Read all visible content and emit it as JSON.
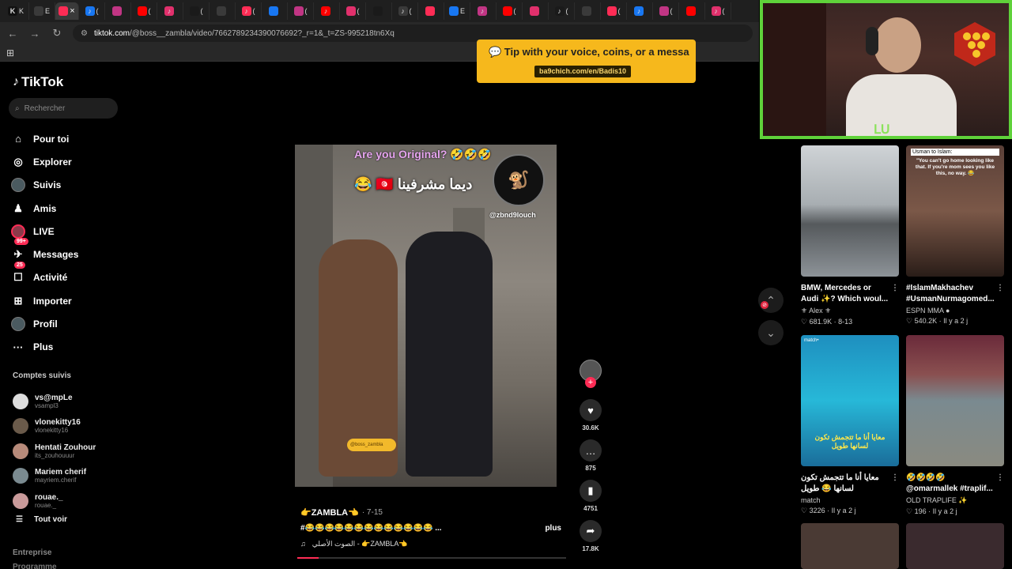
{
  "browser": {
    "tabs": [
      "K",
      "E",
      "",
      "(",
      "",
      "(",
      "",
      "(",
      "",
      "(",
      "",
      "(",
      "",
      "(",
      "",
      "(",
      "",
      "E",
      "",
      "(",
      "",
      "(",
      "",
      "(",
      "",
      "(",
      "",
      "(",
      "",
      "(",
      "",
      "(",
      "",
      "(",
      "",
      "t",
      "",
      "(",
      "",
      "(",
      "",
      "(",
      "",
      "("
    ],
    "url_host": "tiktok.com",
    "url_path": "/@boss__zambla/video/7662789234390076692?_r=1&_t=ZS-995218tn6Xq"
  },
  "sidebar": {
    "logo": "TikTok",
    "search_placeholder": "Rechercher",
    "menu": [
      {
        "label": "Pour toi",
        "icon": "home-icon",
        "glyph": "⌂"
      },
      {
        "label": "Explorer",
        "icon": "compass-icon",
        "glyph": "◎"
      },
      {
        "label": "Suivis",
        "icon": "following-avatar-icon",
        "glyph": "●"
      },
      {
        "label": "Amis",
        "icon": "friends-icon",
        "glyph": "♟"
      },
      {
        "label": "LIVE",
        "icon": "live-avatar-icon",
        "glyph": "●"
      },
      {
        "label": "Messages",
        "icon": "messages-icon",
        "glyph": "✈",
        "badge": "99+"
      },
      {
        "label": "Activité",
        "icon": "activity-icon",
        "glyph": "☐",
        "badge": "25"
      },
      {
        "label": "Importer",
        "icon": "upload-icon",
        "glyph": "⊞"
      },
      {
        "label": "Profil",
        "icon": "profile-avatar-icon",
        "glyph": "●"
      },
      {
        "label": "Plus",
        "icon": "more-icon",
        "glyph": "···"
      }
    ],
    "following_title": "Comptes suivis",
    "following": [
      {
        "name": "vs@mpLe",
        "handle": "vsampl3",
        "color": "#ddd"
      },
      {
        "name": "vlonekitty16",
        "handle": "vlonekitty16",
        "color": "#6a5a4a"
      },
      {
        "name": "Hentati Zouhour",
        "handle": "its_zouhouuur",
        "color": "#b78a7a"
      },
      {
        "name": "Mariem cherif",
        "handle": "mayriem.cherif",
        "color": "#7a8a90"
      },
      {
        "name": "rouae._",
        "handle": "rouae._",
        "color": "#c99a9a"
      }
    ],
    "see_all": "Tout voir",
    "see_all_icon": "list-icon",
    "footer1": "Entreprise",
    "footer2": "Programme"
  },
  "video": {
    "overlay_title": "Are you Original? 🤣🤣🤣",
    "overlay_arabic": "😂 🇹🇳 ديما مشرفينا",
    "overlay_logo_text": "@zbnd9louch",
    "sticker_text": "@boss_zambla",
    "author": "👉ZAMBLA👈",
    "date": "· 7-15",
    "description": "#😂😂😂😂😂😂😂😂😂😂😂😂😂 ...",
    "more": "plus",
    "music": "الصوت الأصلي - 👉ZAMBLA👈",
    "progress": 0.08,
    "likes": "30.6K",
    "comments": "875",
    "saves": "4751",
    "shares": "17.8K"
  },
  "tip": {
    "text": "💬 Tip with your voice, coins, or a messa",
    "url": "ba9chich.com/en/Badis10"
  },
  "feed": [
    {
      "title": "BMW, Mercedes or Audi ✨? Which woul...",
      "author": "⚜ Alex ⚜",
      "stats": "♡ 681.9K · 8-13",
      "bg": "linear-gradient(180deg,#cfd3d6 0%,#a8aeb2 45%,#55595c 60%,#8d9398 100%)",
      "overlay": ""
    },
    {
      "title": "#IslamMakhachev #UsmanNurmagomed...",
      "author": "ESPN MMA ●",
      "stats": "♡ 540.2K · Il y a 2 j",
      "bg": "linear-gradient(180deg,#5a4038 0%,#7b5848 50%,#2a1d18 100%)",
      "overlay": "Usman to Islam:",
      "caption": "\"You can't go home looking like that. If you're mom sees you like this, no way. 😂"
    },
    {
      "title": "معايا أنا ما تتجمش تكون لسانها 😂 طويل",
      "author": "match",
      "stats": "♡ 3226 · Il y a 2 j",
      "bg": "linear-gradient(180deg,#1e8fbf 0%,#27b8d8 50%,#1a6d9a 100%)",
      "overlay": "match•",
      "caption": "معايا أنا ما تتجمش تكون لسانها طويل"
    },
    {
      "title": "🤣🤣🤣🤣 @omarmallek #traplif...",
      "author": "OLD TRAPLIFE ✨",
      "stats": "♡ 196 · Il y a 2 j",
      "bg": "linear-gradient(180deg,#6a2a3a 0%,#8a5050 30%,#7a8a90 50%,#8a8a80 100%)",
      "overlay": ""
    }
  ]
}
